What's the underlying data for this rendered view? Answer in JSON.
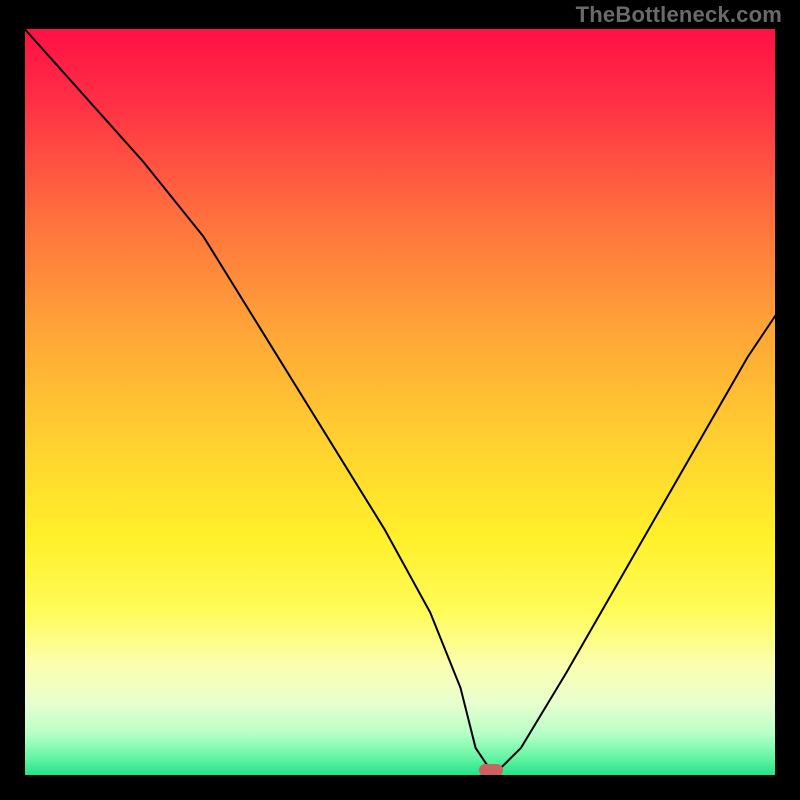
{
  "watermark": "TheBottleneck.com",
  "chart_data": {
    "type": "line",
    "title": "",
    "xlabel": "",
    "ylabel": "",
    "xlim": [
      0,
      100
    ],
    "ylim": [
      0,
      100
    ],
    "grid": false,
    "legend": false,
    "series": [
      {
        "name": "bottleneck-curve",
        "x": [
          0,
          8,
          16,
          24,
          32,
          40,
          48,
          54,
          58,
          60,
          62,
          63,
          66,
          72,
          80,
          88,
          96,
          100
        ],
        "y": [
          100,
          91,
          82,
          72,
          59,
          46,
          33,
          22,
          12,
          4,
          1,
          1,
          4,
          14,
          28,
          42,
          56,
          62
        ],
        "stroke": "#000000",
        "stroke_width": 2
      }
    ],
    "annotations": [
      {
        "name": "bottleneck-marker",
        "shape": "rounded-rect",
        "x": 62,
        "y": 1,
        "fill": "#cc6161"
      }
    ],
    "background_gradient": {
      "type": "vertical",
      "stops": [
        {
          "offset": 0.0,
          "color": "#ff0f45"
        },
        {
          "offset": 0.1,
          "color": "#ff2f45"
        },
        {
          "offset": 0.25,
          "color": "#ff6e3e"
        },
        {
          "offset": 0.4,
          "color": "#ffa338"
        },
        {
          "offset": 0.55,
          "color": "#ffd030"
        },
        {
          "offset": 0.68,
          "color": "#fff02a"
        },
        {
          "offset": 0.78,
          "color": "#fffc5a"
        },
        {
          "offset": 0.85,
          "color": "#fbffb0"
        },
        {
          "offset": 0.9,
          "color": "#e8ffce"
        },
        {
          "offset": 0.94,
          "color": "#b8ffc7"
        },
        {
          "offset": 0.97,
          "color": "#6cf7a8"
        },
        {
          "offset": 1.0,
          "color": "#17e183"
        }
      ]
    }
  },
  "colors": {
    "page_bg": "#000000",
    "border": "#000000",
    "watermark": "#6a6a6a",
    "marker": "#cc6161"
  }
}
